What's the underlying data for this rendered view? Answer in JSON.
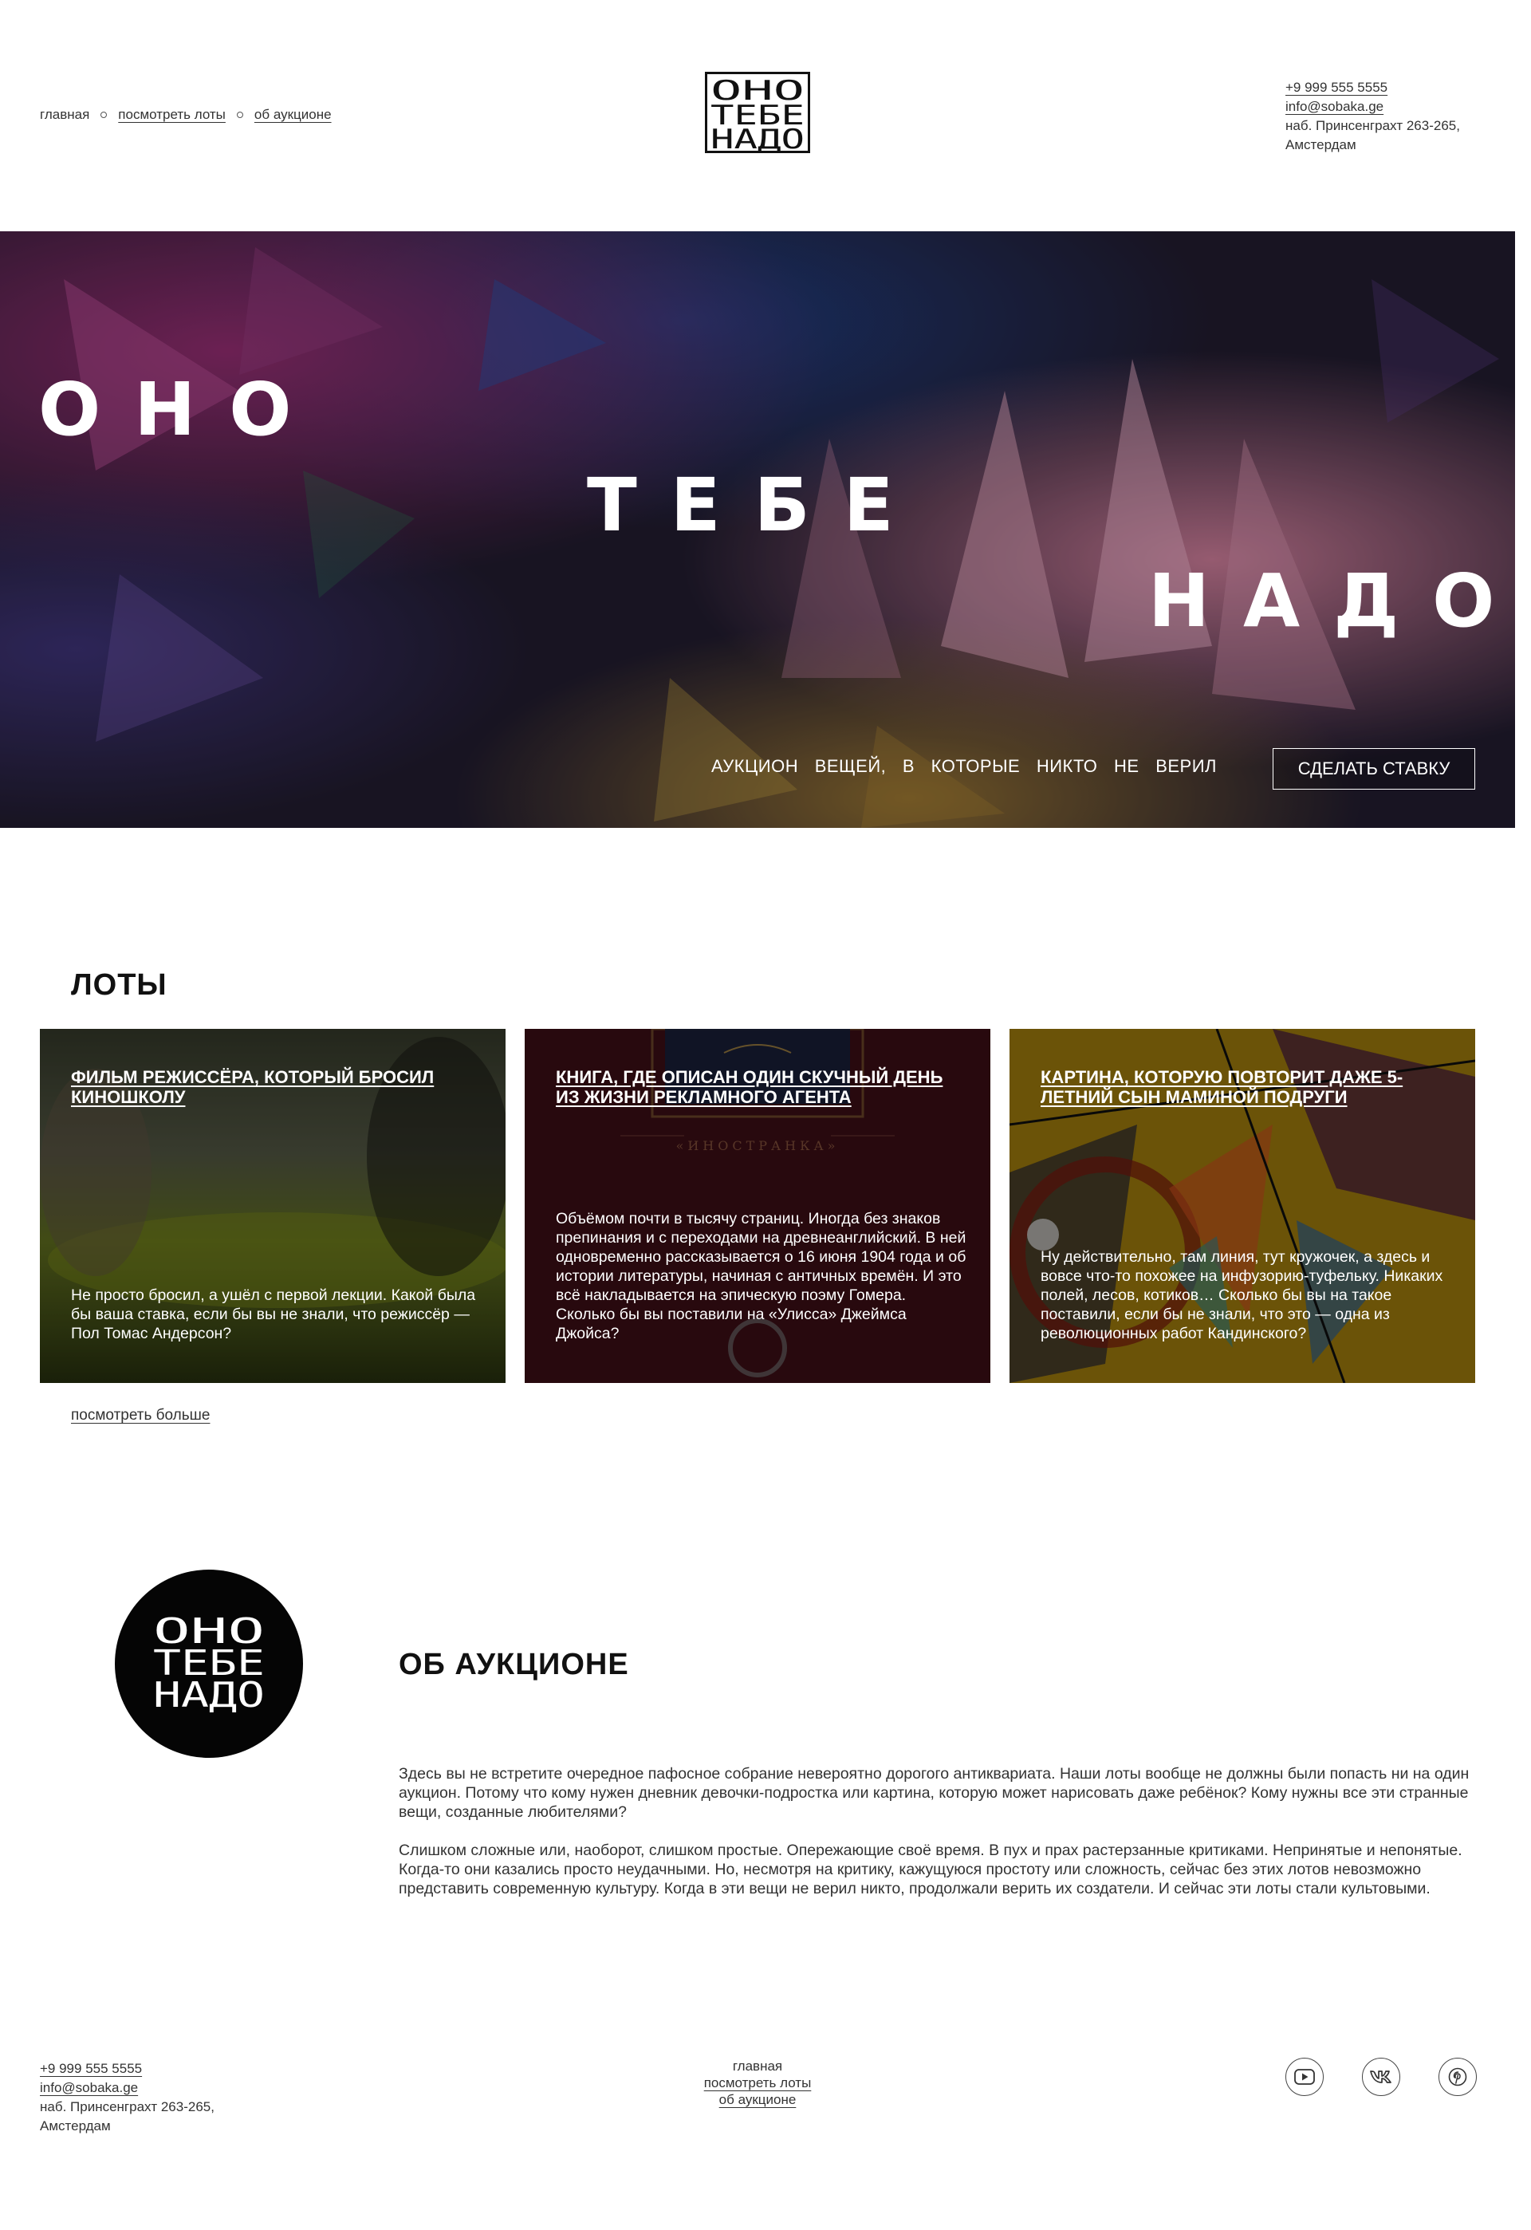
{
  "header": {
    "nav": [
      {
        "label": "главная"
      },
      {
        "label": "посмотреть лоты"
      },
      {
        "label": "об аукционе"
      }
    ],
    "logo_lines": [
      "ОНО",
      "ТЕБЕ",
      "НАДО"
    ],
    "contacts": {
      "phone": "+9 999 555 5555",
      "email": "info@sobaka.ge",
      "address_1": "наб. Принсенграхт 263-265,",
      "address_2": "Амстердам"
    }
  },
  "hero": {
    "word1": "ОНО",
    "word2": "ТЕБЕ",
    "word3": "НАДО",
    "tagline": "АУКЦИОН ВЕЩЕЙ, В КОТОРЫЕ НИКТО НЕ ВЕРИЛ",
    "cta_label": "СДЕЛАТЬ СТАВКУ"
  },
  "lots": {
    "title": "ЛОТЫ",
    "cards": [
      {
        "title": "ФИЛЬМ РЕЖИССЁРА, КОТОРЫЙ БРОСИЛ КИНОШКОЛУ",
        "description": "Не просто бросил, а ушёл с первой лекции. Какой была бы ваша ставка, если бы вы не знали, что режиссёр — Пол Томас Андерсон?"
      },
      {
        "title": "КНИГА, ГДЕ ОПИСАН ОДИН СКУЧНЫЙ ДЕНЬ ИЗ ЖИЗНИ РЕКЛАМНОГО АГЕНТА",
        "description": "Объёмом почти в тысячу страниц. Иногда без знаков препинания и с переходами на древнеанглийский. В ней одновременно рассказывается о 16 июня 1904 года и об истории литературы, начиная с античных времён. И это всё накладывается на эпическую поэму Гомера. Сколько бы вы поставили на «Улисса» Джеймса Джойса?",
        "book_label": "«ИНОСТРАНКА»"
      },
      {
        "title": "КАРТИНА, КОТОРУЮ ПОВТОРИТ ДАЖЕ 5-ЛЕТНИЙ СЫН МАМИНОЙ ПОДРУГИ",
        "description": "Ну действительно, там линия, тут кружочек, а здесь и вовсе что-то похожее на инфузорию-туфельку. Никаких полей, лесов, котиков… Сколько бы вы на такое поставили, если бы не знали, что это — одна из революционных работ Кандинского?"
      }
    ],
    "more_label": "посмотреть больше"
  },
  "about": {
    "title": "ОБ АУКЦИОНЕ",
    "paragraph_1": "Здесь вы не встретите очередное пафосное собрание невероятно дорогого антиквариата. Наши лоты вообще не должны были попасть ни на один аукцион. Потому что кому нужен дневник девочки-подростка или картина, которую может нарисовать даже ребёнок? Кому нужны все эти странные вещи, созданные любителями?",
    "paragraph_2": "Слишком сложные или, наоборот, слишком простые. Опережающие своё время. В пух и прах растерзанные критиками. Непринятые и непонятые. Когда-то они казались просто неудачными. Но, несмотря на критику, кажущуюся простоту или сложность, сейчас без этих лотов невозможно представить современную культуру. Когда в эти вещи не верил никто, продолжали верить их создатели. И сейчас эти лоты стали культовыми."
  },
  "footer": {
    "contacts": {
      "phone": "+9 999 555 5555",
      "email": "info@sobaka.ge",
      "address_1": "наб. Принсенграхт 263-265,",
      "address_2": "Амстердам"
    },
    "nav": [
      {
        "label": "главная"
      },
      {
        "label": "посмотреть лоты"
      },
      {
        "label": "об аукционе"
      }
    ],
    "socials": [
      {
        "icon": "youtube-icon"
      },
      {
        "icon": "vk-icon"
      },
      {
        "icon": "pinterest-icon"
      }
    ]
  }
}
